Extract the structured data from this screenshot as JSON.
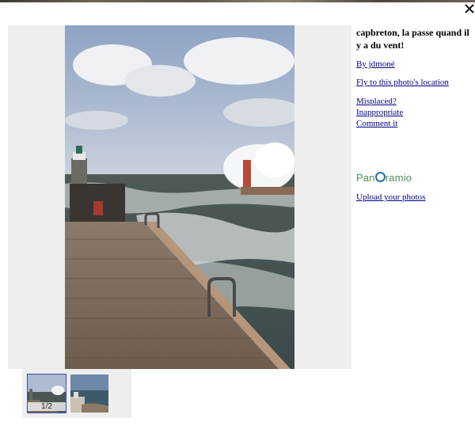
{
  "viewer": {
    "close_label": "×",
    "photo_title": "capbreton, la passe quand il y a du vent!",
    "author_link": "By jdmoné",
    "fly_link": "Fly to this photo's location",
    "misplaced_link": "Misplaced?",
    "inappropriate_link": "Inappropriate",
    "comment_link": "Comment it",
    "logo_text_before": "Pan",
    "logo_text_after": "ramio",
    "upload_link": "Upload your photos"
  },
  "thumbnails": {
    "counter": "1/2"
  },
  "colors": {
    "link": "#00007f",
    "panel_bg": "#eeeeee",
    "logo_green": "#4f8f55",
    "logo_blue": "#2c6fa6",
    "thumb_border": "#3a4fb5"
  }
}
